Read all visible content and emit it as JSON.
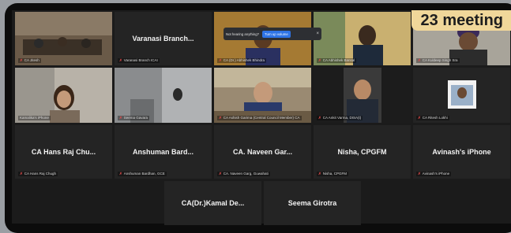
{
  "banner": {
    "text": "23 meeting"
  },
  "notice": {
    "text": "Not hearing anything?",
    "button": "Turn up volume",
    "close": "×"
  },
  "row1": [
    {
      "label": "CA Jitesh"
    },
    {
      "center": "Varanasi Branch...",
      "label": "Varanasi Branch ICAI"
    },
    {
      "label": "CA (Dr.) Abhishek Bhindra"
    },
    {
      "label": "CA Abhishek Bansal"
    },
    {
      "label": "CA Kuldeep Singh Sra"
    }
  ],
  "row2": [
    {
      "label": "Kamalika's iPhone"
    },
    {
      "label": "Seema Gavara"
    },
    {
      "label": "CA Ashish Garima (Central Council Member) CA"
    },
    {
      "label": "CA Ankit Varma, DISA(t)"
    },
    {
      "label": "CA Ritesh Lokhi"
    }
  ],
  "row3": [
    {
      "center": "CA Hans Raj Chu...",
      "label": "CA Hans Raj Chugh"
    },
    {
      "center": "Anshuman Bard...",
      "label": "Anshuman Bardhan, GCE"
    },
    {
      "center": "CA. Naveen Gar...",
      "label": "CA. Naveen Garg, Guwahati"
    },
    {
      "center": "Nisha, CPGFM",
      "label": "Nisha, CPGFM"
    },
    {
      "center": "Avinash's iPhone",
      "label": "Avinash's iPhone"
    }
  ],
  "row4": [
    {
      "center": "CA(Dr.)Kamal De..."
    },
    {
      "center": "Seema Girotra"
    }
  ],
  "colors": {
    "active_outline": "#c4d94a",
    "mic_off": "#e24a4a",
    "button": "#2e74e6"
  },
  "icons": [
    "mic-muted-icon",
    "close-icon"
  ]
}
